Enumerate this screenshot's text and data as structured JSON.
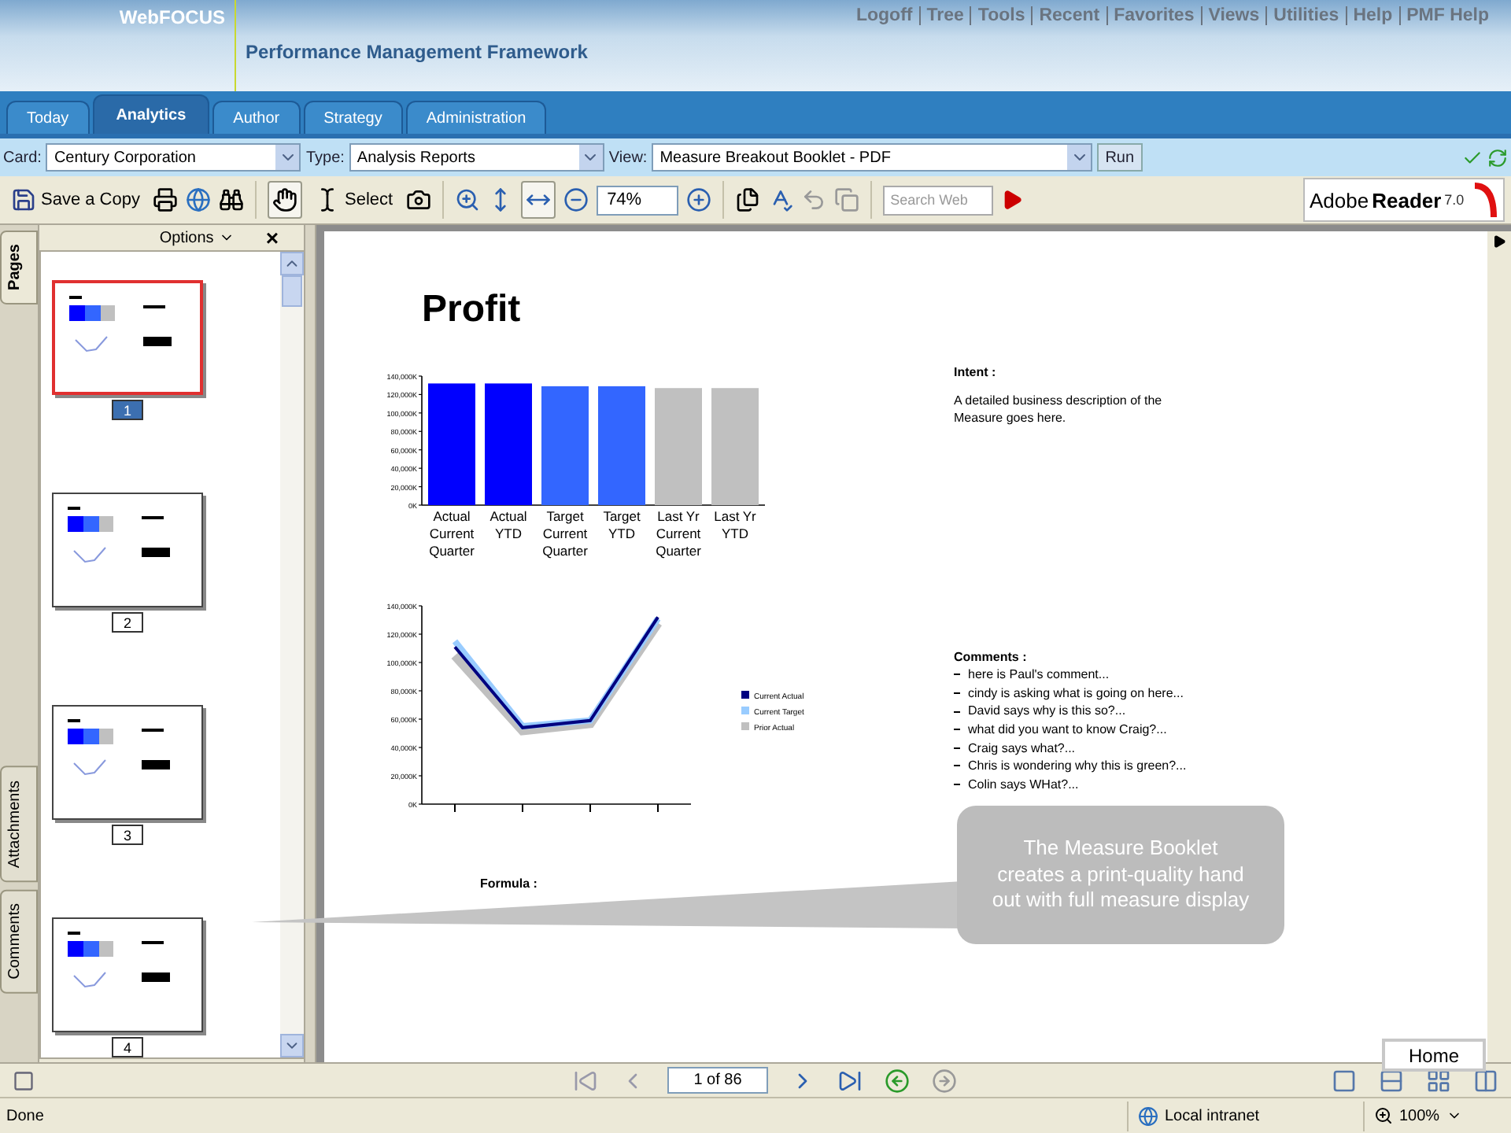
{
  "header": {
    "product": "WebFOCUS",
    "subtitle": "Performance Management Framework",
    "links": [
      "Logoff",
      "Tree",
      "Tools",
      "Recent",
      "Favorites",
      "Views",
      "Utilities",
      "Help",
      "PMF Help"
    ]
  },
  "tabs": [
    {
      "label": "Today",
      "selected": false
    },
    {
      "label": "Analytics",
      "selected": true
    },
    {
      "label": "Author",
      "selected": false
    },
    {
      "label": "Strategy",
      "selected": false
    },
    {
      "label": "Administration",
      "selected": false
    }
  ],
  "filters": [
    {
      "label": "Card:",
      "value": "Century Corporation"
    },
    {
      "label": "Type:",
      "value": "Analysis Reports"
    },
    {
      "label": "View:",
      "value": "Measure Breakout Booklet - PDF"
    }
  ],
  "run_button": "Run",
  "toolbar": {
    "save": "Save a Copy",
    "select": "Select",
    "zoom": "74%",
    "search_placeholder": "Search Web",
    "brand": "Adobe",
    "product": "Reader",
    "version": "7.0"
  },
  "side_tabs": [
    {
      "label": "Pages",
      "selected": true
    },
    {
      "label": "Attachments",
      "selected": false
    },
    {
      "label": "Comments",
      "selected": false
    }
  ],
  "pages_panel": {
    "options": "Options",
    "close": "×",
    "thumbnails": [
      {
        "number": "1",
        "selected": true
      },
      {
        "number": "2",
        "selected": false
      },
      {
        "number": "3",
        "selected": false
      },
      {
        "number": "4",
        "selected": false
      }
    ]
  },
  "document": {
    "title": "Profit",
    "bar_chart": {
      "chart_data": {
        "type": "bar",
        "categories": [
          "Actual Current Quarter",
          "Actual YTD",
          "Target Current Quarter",
          "Target YTD",
          "Last Yr Current Quarter",
          "Last Yr YTD"
        ],
        "values": [
          132000,
          132000,
          129000,
          129000,
          127000,
          127000
        ],
        "colors": [
          "#0000ff",
          "#0000ff",
          "#3366ff",
          "#3366ff",
          "#c0c0c0",
          "#c0c0c0"
        ],
        "ylim": [
          0,
          140000
        ],
        "yticks": [
          {
            "value": 0,
            "label": "0K"
          },
          {
            "value": 20000,
            "label": "20,000K"
          },
          {
            "value": 40000,
            "label": "40,000K"
          },
          {
            "value": 60000,
            "label": "60,000K"
          },
          {
            "value": 80000,
            "label": "80,000K"
          },
          {
            "value": 100000,
            "label": "100,000K"
          },
          {
            "value": 120000,
            "label": "120,000K"
          },
          {
            "value": 140000,
            "label": "140,000K"
          }
        ]
      }
    },
    "line_chart": {
      "chart_data": {
        "type": "line",
        "legend": "right",
        "ylim": [
          0,
          140000
        ],
        "yticks": [
          {
            "value": 0,
            "label": "0K"
          },
          {
            "value": 20000,
            "label": "20,000K"
          },
          {
            "value": 40000,
            "label": "40,000K"
          },
          {
            "value": 60000,
            "label": "60,000K"
          },
          {
            "value": 80000,
            "label": "80,000K"
          },
          {
            "value": 100000,
            "label": "100,000K"
          },
          {
            "value": 120000,
            "label": "120,000K"
          },
          {
            "value": 140000,
            "label": "140,000K"
          }
        ],
        "series": [
          {
            "name": "Current Actual",
            "color": "#000080",
            "values": [
              111000,
              54000,
              59000,
              132000
            ]
          },
          {
            "name": "Current Target",
            "color": "#99ccff",
            "values": [
              115000,
              55000,
              59000,
              131000
            ]
          },
          {
            "name": "Prior Actual",
            "color": "#c0c0c0",
            "values": [
              105000,
              52000,
              57000,
              128000
            ]
          }
        ]
      }
    },
    "intent_label": "Intent :",
    "intent_text": "A detailed business description of the Measure goes here.",
    "comments_label": "Comments :",
    "comments": [
      "here is Paul's comment...",
      "cindy is asking what is going on here...",
      "David says why is this so?...",
      "what did you want to know Craig?...",
      "Craig says what?...",
      "Chris is wondering why this is green?...",
      "Colin says WHat?..."
    ],
    "formula_label": "Formula :"
  },
  "callout": "The Measure Booklet creates a print-quality hand out with full measure display",
  "home": "Home",
  "navigation": {
    "page": "1 of 86"
  },
  "status_bar": {
    "text": "Done",
    "zone": "Local intranet",
    "zoom": "100%"
  }
}
